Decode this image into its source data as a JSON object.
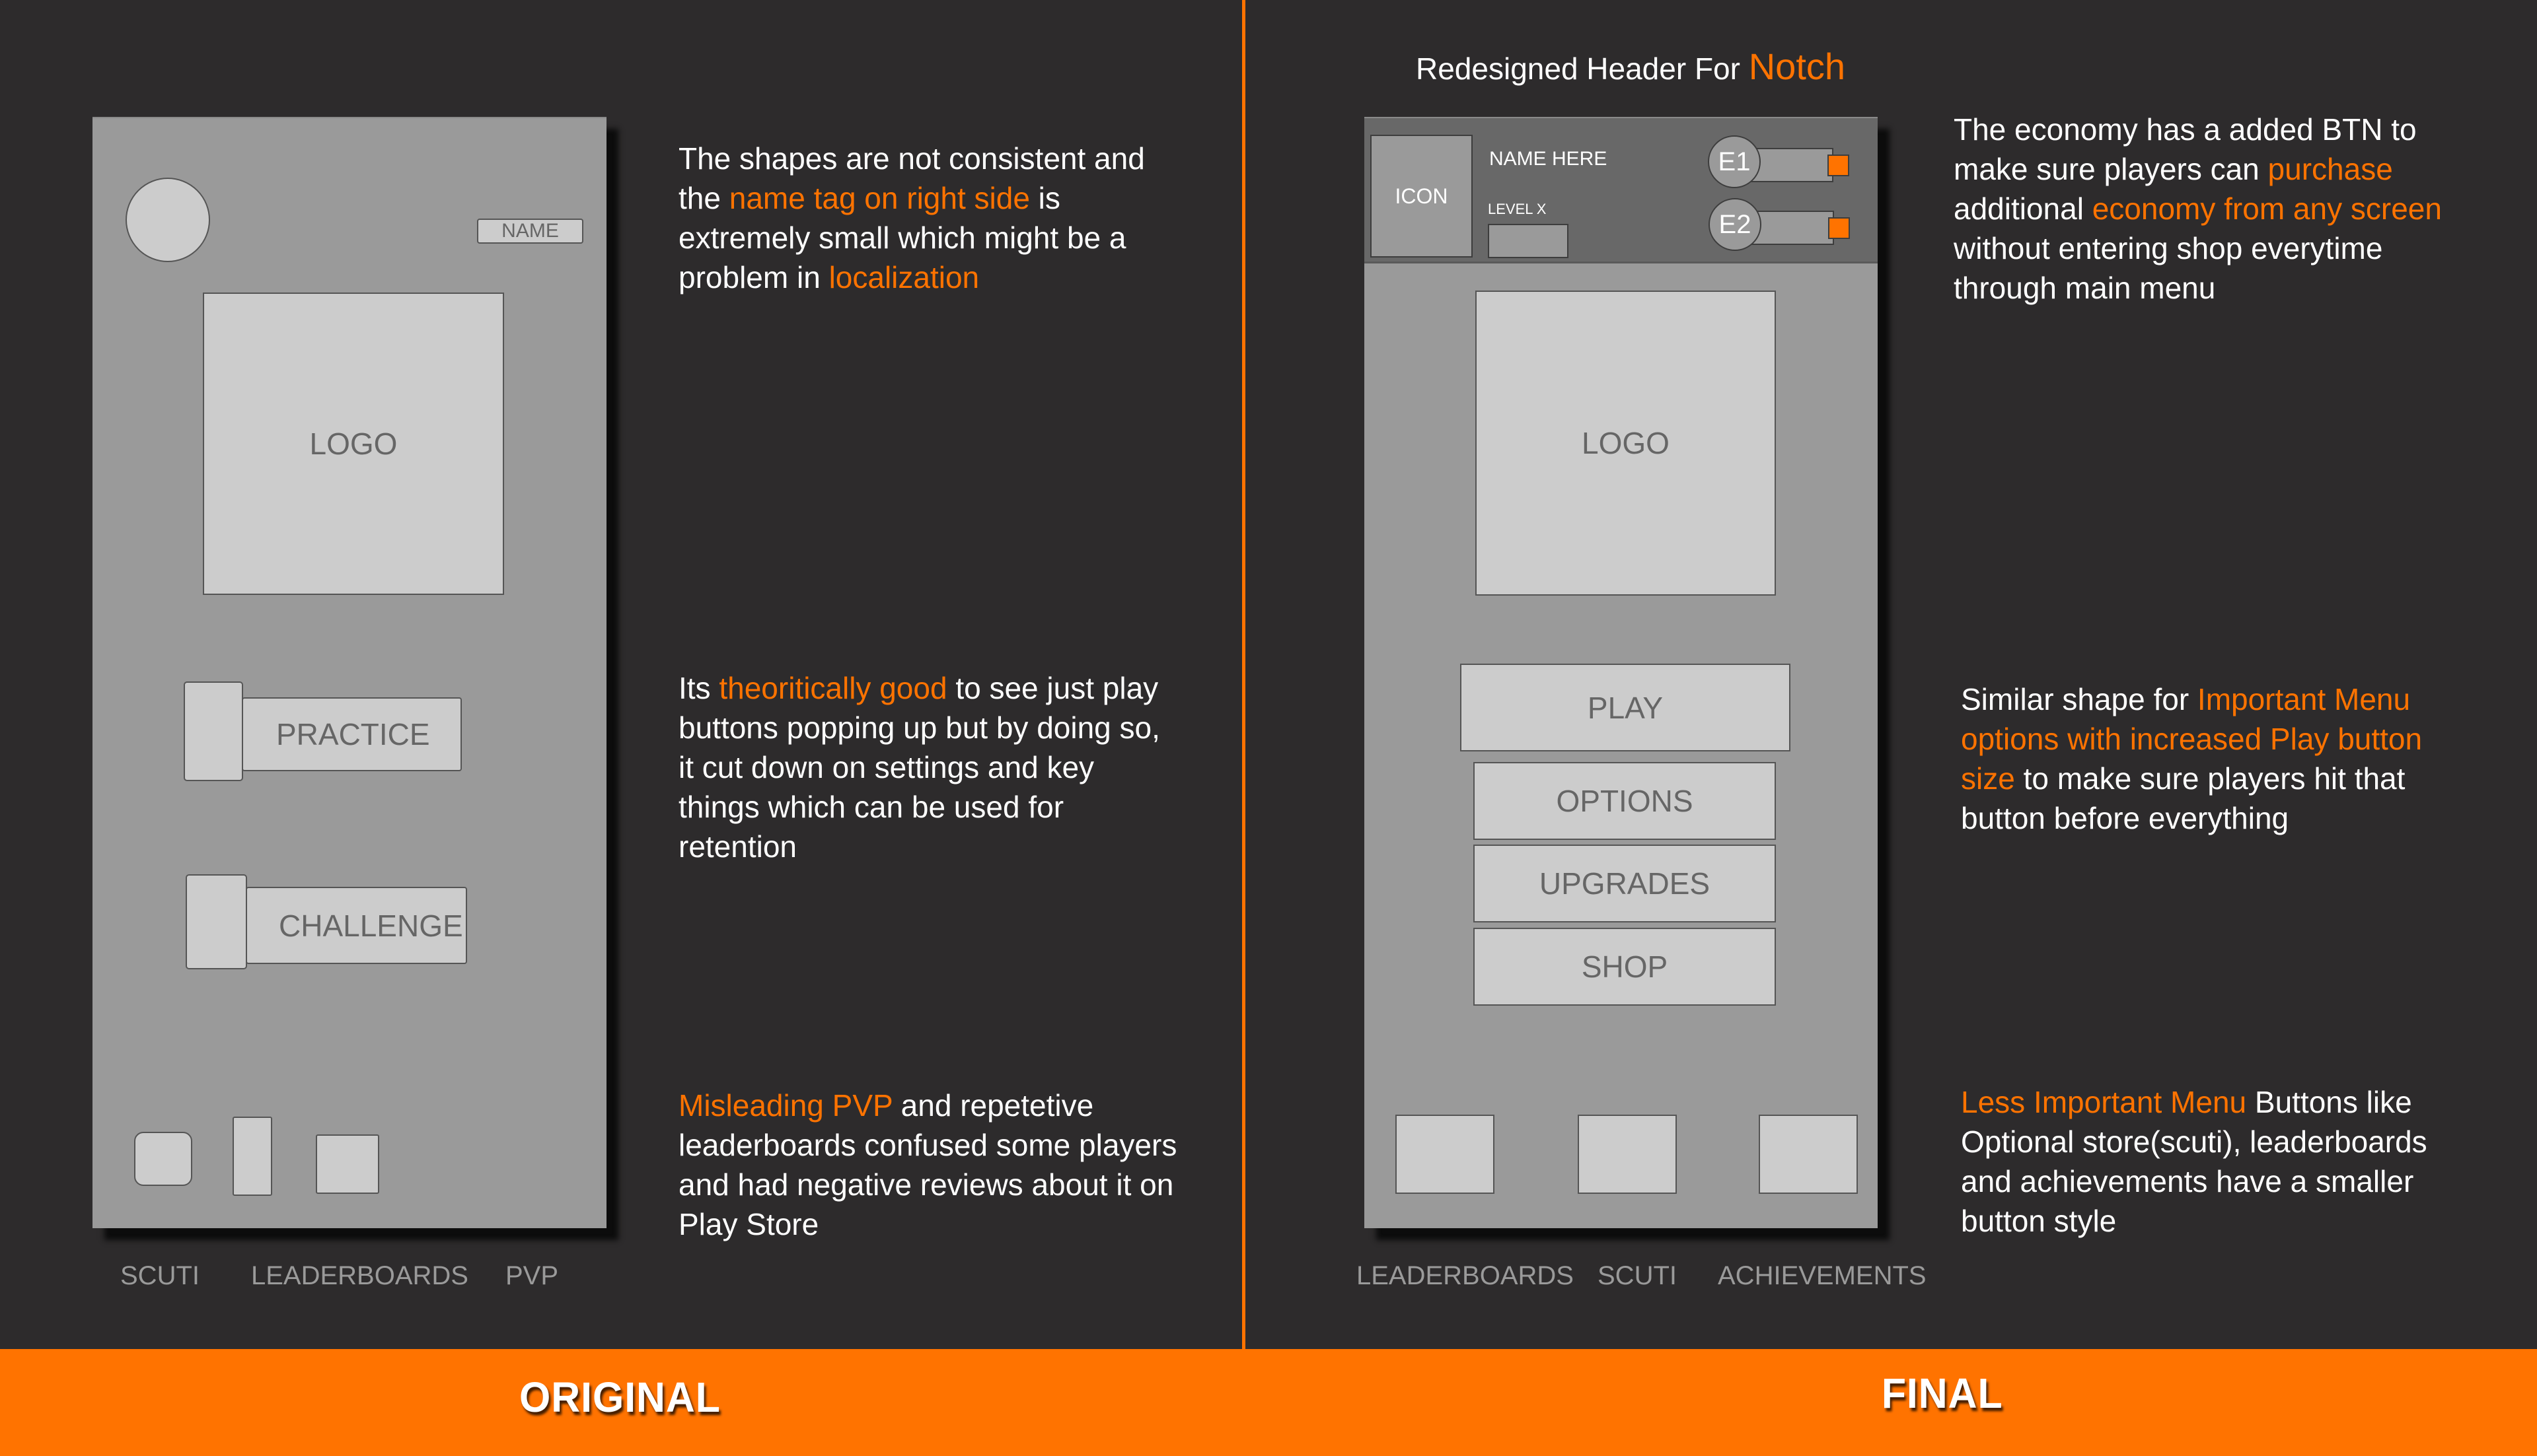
{
  "accent_color": "#ff7300",
  "background_color": "#2d2b2c",
  "footer": {
    "original_label": "ORIGINAL",
    "final_label": "FINAL"
  },
  "original": {
    "name_tag": "NAME",
    "logo": "LOGO",
    "buttons": [
      "PRACTICE",
      "CHALLENGE"
    ],
    "bottom_labels": [
      "SCUTI",
      "LEADERBOARDS",
      "PVP"
    ],
    "notes": [
      {
        "segments": [
          {
            "text": "The shapes are not consistent and the ",
            "highlight": false
          },
          {
            "text": "name tag on right side",
            "highlight": true
          },
          {
            "text": " is extremely small which might be a problem in ",
            "highlight": false
          },
          {
            "text": "localization",
            "highlight": true
          }
        ]
      },
      {
        "segments": [
          {
            "text": "Its ",
            "highlight": false
          },
          {
            "text": "theoritically good",
            "highlight": true
          },
          {
            "text": " to see just play buttons popping up but by doing so, it cut down on settings and key things which can be used for retention",
            "highlight": false
          }
        ]
      },
      {
        "segments": [
          {
            "text": "Misleading PVP",
            "highlight": true
          },
          {
            "text": " and repetetive leaderboards confused some players and had negative reviews about it on Play Store",
            "highlight": false
          }
        ]
      }
    ]
  },
  "final": {
    "title_prefix": "Redesigned Header For ",
    "title_highlight": "Notch",
    "header": {
      "icon": "ICON",
      "name": "NAME HERE",
      "level": "LEVEL X",
      "economies": [
        "E1",
        "E2"
      ]
    },
    "logo": "LOGO",
    "buttons": [
      "PLAY",
      "OPTIONS",
      "UPGRADES",
      "SHOP"
    ],
    "bottom_labels": [
      "LEADERBOARDS",
      "SCUTI",
      "ACHIEVEMENTS"
    ],
    "notes": [
      {
        "segments": [
          {
            "text": "The economy has a added BTN to make sure players can ",
            "highlight": false
          },
          {
            "text": "purchase",
            "highlight": true
          },
          {
            "text": " additional ",
            "highlight": false
          },
          {
            "text": "economy from any screen",
            "highlight": true
          },
          {
            "text": " without entering shop everytime through main menu",
            "highlight": false
          }
        ]
      },
      {
        "segments": [
          {
            "text": "Similar shape for ",
            "highlight": false
          },
          {
            "text": "Important Menu options with increased Play button size",
            "highlight": true
          },
          {
            "text": " to make sure players hit that button before everything",
            "highlight": false
          }
        ]
      },
      {
        "segments": [
          {
            "text": "Less Important Menu",
            "highlight": true
          },
          {
            "text": " Buttons like Optional store(scuti), leaderboards and achievements have a smaller button style",
            "highlight": false
          }
        ]
      }
    ]
  }
}
